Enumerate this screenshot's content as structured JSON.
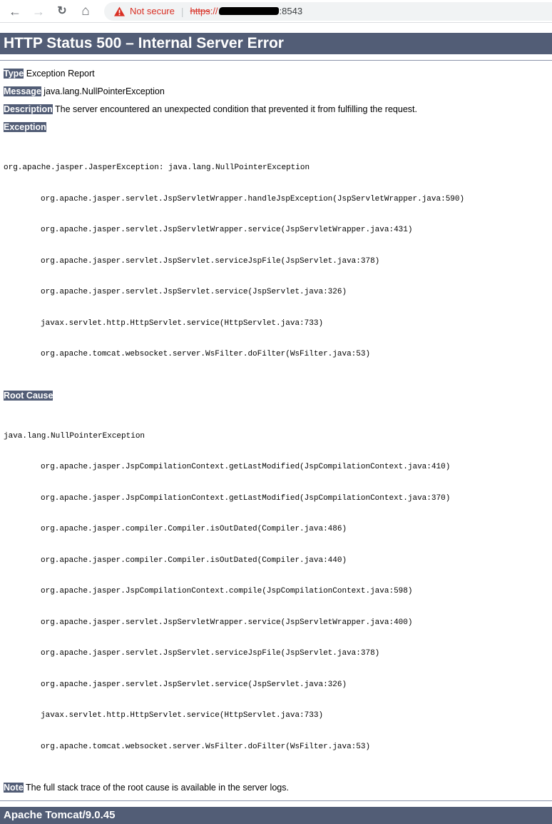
{
  "browser": {
    "back_icon": "←",
    "forward_icon": "→",
    "reload_icon": "↻",
    "home_icon": "⌂",
    "security_label": "Not secure",
    "url_separator": "|",
    "url": {
      "scheme": "https",
      "scheme_suffix": "://",
      "port": ":8543"
    }
  },
  "page": {
    "title": "HTTP Status 500 – Internal Server Error",
    "type_label": "Type",
    "type_value": "Exception Report",
    "message_label": "Message",
    "message_value": "java.lang.NullPointerException",
    "description_label": "Description",
    "description_value": "The server encountered an unexpected condition that prevented it from fulfilling the request.",
    "exception_label": "Exception",
    "exception": {
      "title": "org.apache.jasper.JasperException: java.lang.NullPointerException",
      "frames": [
        "org.apache.jasper.servlet.JspServletWrapper.handleJspException(JspServletWrapper.java:590)",
        "org.apache.jasper.servlet.JspServletWrapper.service(JspServletWrapper.java:431)",
        "org.apache.jasper.servlet.JspServlet.serviceJspFile(JspServlet.java:378)",
        "org.apache.jasper.servlet.JspServlet.service(JspServlet.java:326)",
        "javax.servlet.http.HttpServlet.service(HttpServlet.java:733)",
        "org.apache.tomcat.websocket.server.WsFilter.doFilter(WsFilter.java:53)"
      ]
    },
    "root_cause_label": "Root Cause",
    "root_cause": {
      "title": "java.lang.NullPointerException",
      "frames": [
        "org.apache.jasper.JspCompilationContext.getLastModified(JspCompilationContext.java:410)",
        "org.apache.jasper.JspCompilationContext.getLastModified(JspCompilationContext.java:370)",
        "org.apache.jasper.compiler.Compiler.isOutDated(Compiler.java:486)",
        "org.apache.jasper.compiler.Compiler.isOutDated(Compiler.java:440)",
        "org.apache.jasper.JspCompilationContext.compile(JspCompilationContext.java:598)",
        "org.apache.jasper.servlet.JspServletWrapper.service(JspServletWrapper.java:400)",
        "org.apache.jasper.servlet.JspServlet.serviceJspFile(JspServlet.java:378)",
        "org.apache.jasper.servlet.JspServlet.service(JspServlet.java:326)",
        "javax.servlet.http.HttpServlet.service(HttpServlet.java:733)",
        "org.apache.tomcat.websocket.server.WsFilter.doFilter(WsFilter.java:53)"
      ]
    },
    "note_label": "Note",
    "note_value": "The full stack trace of the root cause is available in the server logs.",
    "footer": "Apache Tomcat/9.0.45"
  },
  "colors": {
    "tomcat_header_bg": "#525D76",
    "alert_red": "#d93025",
    "redaction_black": "#000000",
    "addressbar_bg": "#f1f3f4"
  }
}
